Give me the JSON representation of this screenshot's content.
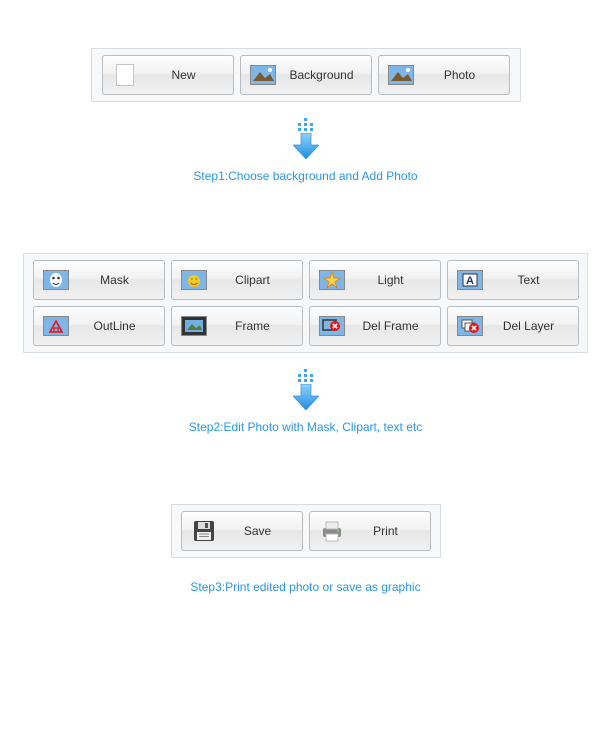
{
  "step1": {
    "caption": "Step1:Choose background and Add Photo",
    "buttons": {
      "new": "New",
      "background": "Background",
      "photo": "Photo"
    }
  },
  "step2": {
    "caption": "Step2:Edit Photo with Mask, Clipart, text etc",
    "buttons": {
      "mask": "Mask",
      "clipart": "Clipart",
      "light": "Light",
      "text": "Text",
      "outline": "OutLine",
      "frame": "Frame",
      "delframe": "Del Frame",
      "dellayer": "Del Layer"
    }
  },
  "step3": {
    "caption": "Step3:Print edited photo or save as graphic",
    "buttons": {
      "save": "Save",
      "print": "Print"
    }
  },
  "colors": {
    "accent": "#2796e6",
    "panel_border": "#d6dde3"
  }
}
